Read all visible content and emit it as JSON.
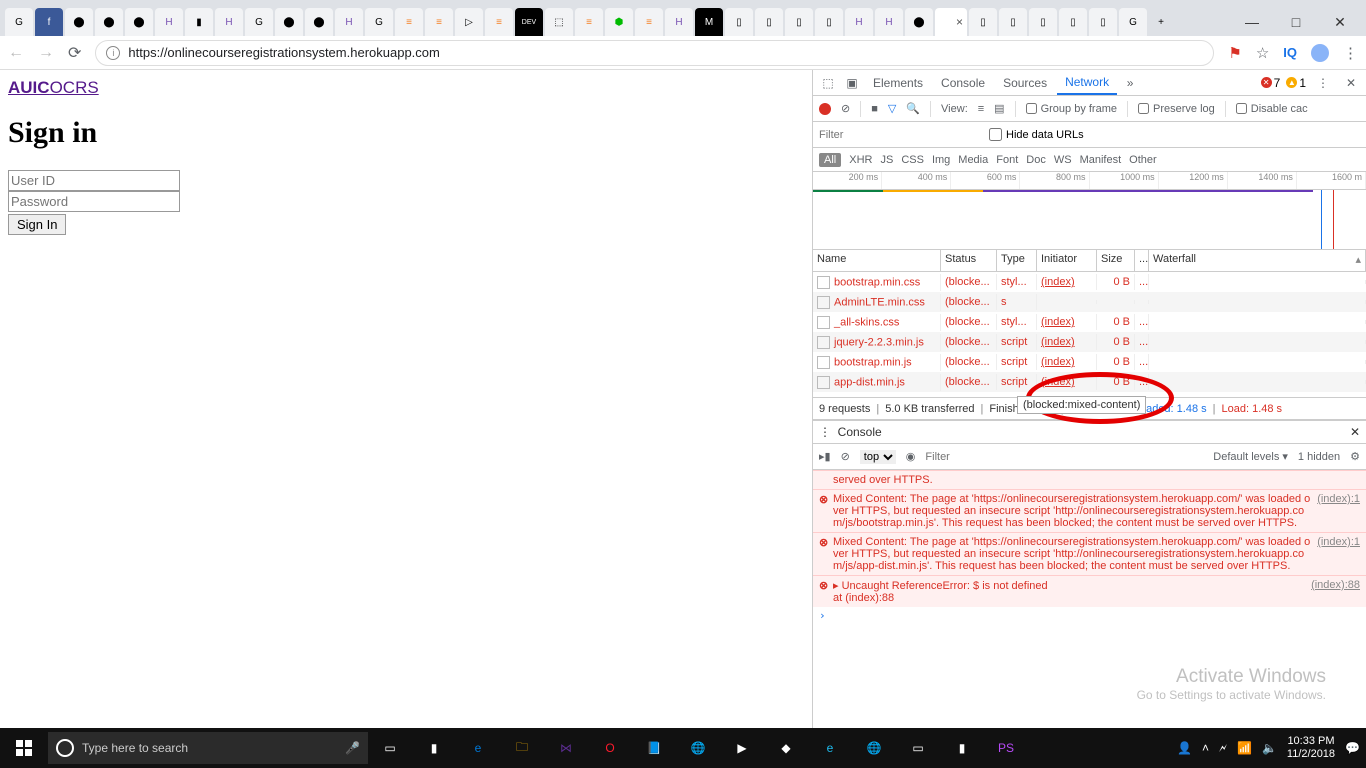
{
  "browser": {
    "url": "https://onlinecourseregistrationsystem.herokuapp.com",
    "tab_close": "×",
    "new_tab": "+",
    "win_min": "—",
    "win_max": "□",
    "win_close": "✕"
  },
  "page": {
    "logo_bold": "AUIC",
    "logo_rest": "OCRS",
    "heading": "Sign in",
    "userid_ph": "User ID",
    "password_ph": "Password",
    "signin_btn": "Sign In"
  },
  "devtools": {
    "tabs": {
      "elements": "Elements",
      "console": "Console",
      "sources": "Sources",
      "network": "Network"
    },
    "err_count": "7",
    "warn_count": "1",
    "toolbar": {
      "view": "View:",
      "group": "Group by frame",
      "preserve": "Preserve log",
      "disable": "Disable cac"
    },
    "filter_ph": "Filter",
    "hide": "Hide data URLs",
    "types": [
      "XHR",
      "JS",
      "CSS",
      "Img",
      "Media",
      "Font",
      "Doc",
      "WS",
      "Manifest",
      "Other"
    ],
    "all": "All",
    "timeline": [
      "200 ms",
      "400 ms",
      "600 ms",
      "800 ms",
      "1000 ms",
      "1200 ms",
      "1400 ms",
      "1600 m"
    ],
    "cols": {
      "name": "Name",
      "status": "Status",
      "type": "Type",
      "initiator": "Initiator",
      "size": "Size",
      "ti": "...",
      "waterfall": "Waterfall"
    },
    "rows": [
      {
        "name": "bootstrap.min.css",
        "status": "(blocke...",
        "type": "styl...",
        "init": "(index)",
        "size": "0 B",
        "ti": "..."
      },
      {
        "name": "AdminLTE.min.css",
        "status": "(blocke...",
        "type": "s",
        "init": "",
        "size": "",
        "ti": ""
      },
      {
        "name": "_all-skins.css",
        "status": "(blocke...",
        "type": "styl...",
        "init": "(index)",
        "size": "0 B",
        "ti": "..."
      },
      {
        "name": "jquery-2.2.3.min.js",
        "status": "(blocke...",
        "type": "script",
        "init": "(index)",
        "size": "0 B",
        "ti": "..."
      },
      {
        "name": "bootstrap.min.js",
        "status": "(blocke...",
        "type": "script",
        "init": "(index)",
        "size": "0 B",
        "ti": "..."
      },
      {
        "name": "app-dist.min.js",
        "status": "(blocke...",
        "type": "script",
        "init": "(index)",
        "size": "0 B",
        "ti": "..."
      }
    ],
    "tooltip": "(blocked:mixed-content)",
    "status": {
      "req": "9 requests",
      "tx": "5.0 KB transferred",
      "fin": "Finish: 1.45 s",
      "dcl_lbl": "DOMContentLoaded: ",
      "dcl_v": "1.48 s",
      "load_lbl": "Load: ",
      "load_v": "1.48 s"
    },
    "console": {
      "title": "Console",
      "ctx": "top",
      "filter_ph": "Filter",
      "levels": "Default levels ▾",
      "hidden": "1 hidden",
      "served": "served over HTTPS.",
      "m1": "Mixed Content: The page at 'https://onlinecourseregistrationsystem.herokuapp.com/' was loaded over HTTPS, but requested an insecure script 'http://onlinecourseregistrationsystem.herokuapp.com/js/bootstrap.min.js'. This request has been blocked; the content must be served over HTTPS.",
      "m1_src": "(index):1",
      "m2": "Mixed Content: The page at 'https://onlinecourseregistrationsystem.herokuapp.com/' was loaded over HTTPS, but requested an insecure script 'http://onlinecourseregistrationsystem.herokuapp.com/js/app-dist.min.js'. This request has been blocked; the content must be served over HTTPS.",
      "m2_src": "(index):1",
      "m3": "▸ Uncaught ReferenceError: $ is not defined",
      "m3b": "    at (index):88",
      "m3_src": "(index):88",
      "prompt": "›"
    }
  },
  "watermark": {
    "big": "Activate Windows",
    "small": "Go to Settings to activate Windows."
  },
  "taskbar": {
    "search_ph": "Type here to search",
    "time": "10:33 PM",
    "date": "11/2/2018"
  }
}
